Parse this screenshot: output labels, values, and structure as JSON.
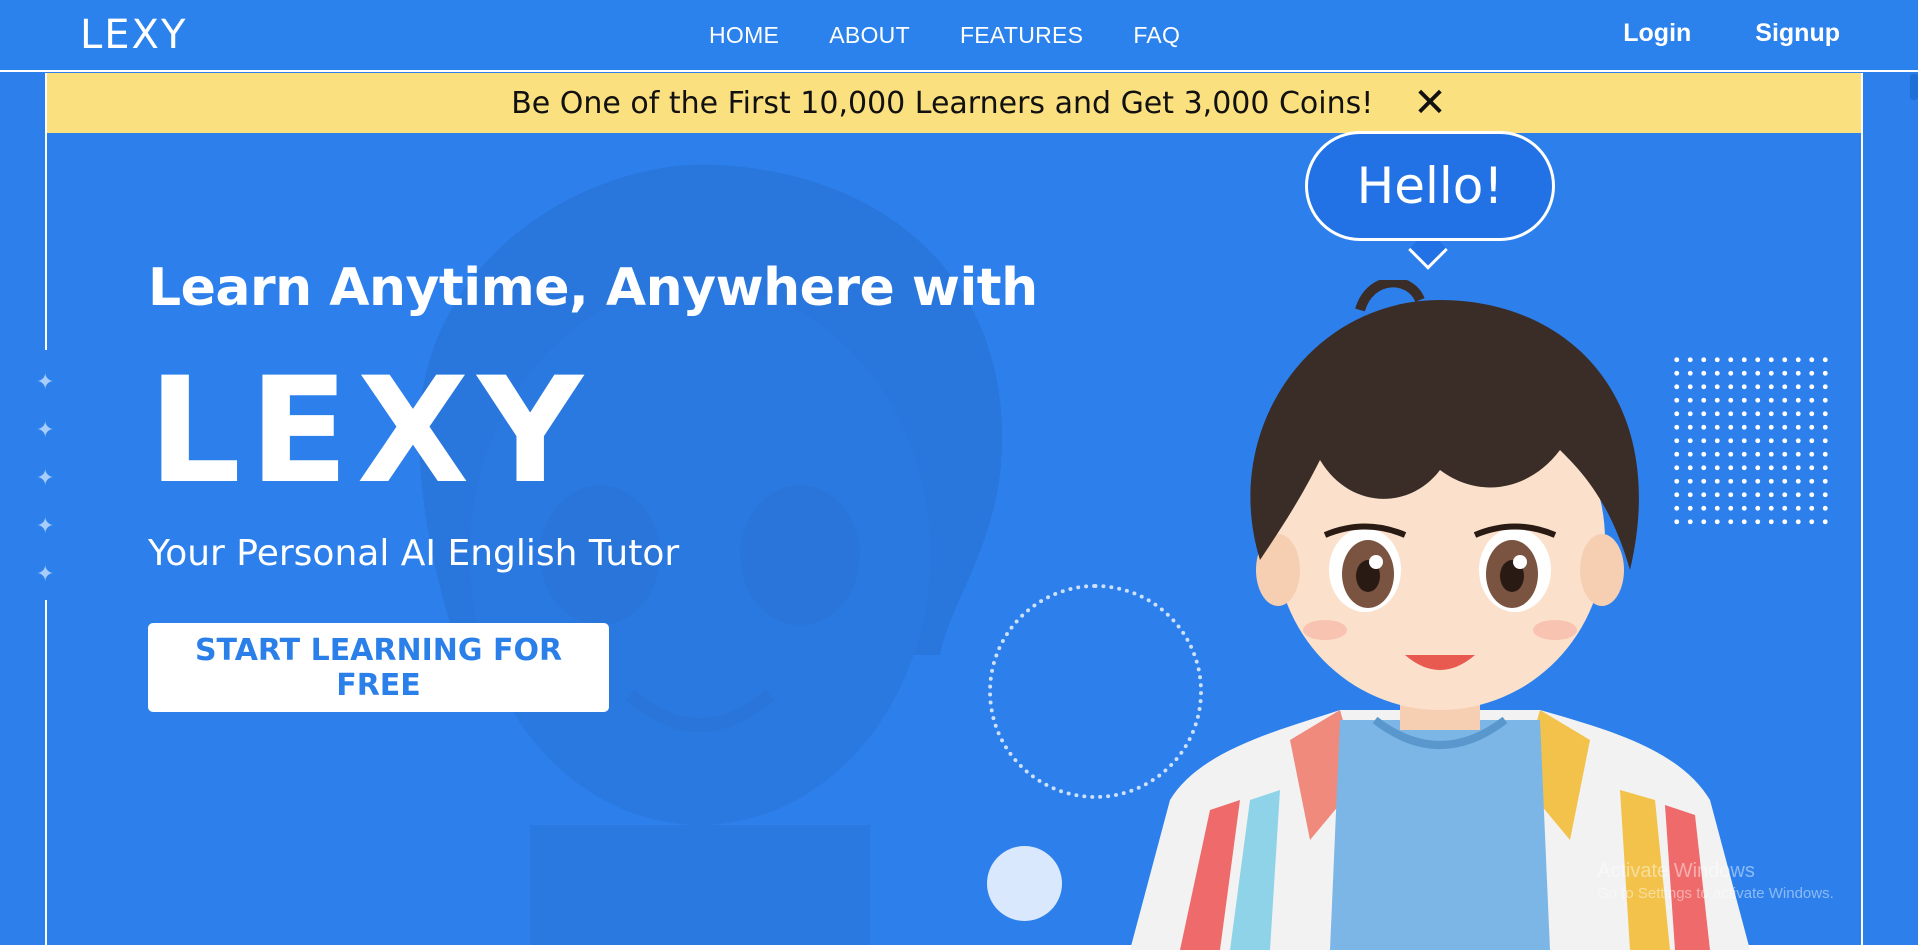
{
  "header": {
    "logo": "LEXY",
    "nav": [
      "HOME",
      "ABOUT",
      "FEATURES",
      "FAQ"
    ],
    "login": "Login",
    "signup": "Signup"
  },
  "banner": {
    "text": "Be One of the First 10,000 Learners and Get 3,000 Coins!",
    "close_glyph": "✕"
  },
  "hero": {
    "headline": "Learn Anytime, Anywhere with",
    "brand": "LEXY",
    "tagline": "Your Personal AI English Tutor",
    "cta": "START LEARNING FOR FREE",
    "speech": "Hello!"
  },
  "watermark": {
    "title": "Activate Windows",
    "subtitle": "Go to Settings to activate Windows."
  },
  "colors": {
    "background": "#2d80ec",
    "banner": "#fbe07f",
    "cta_text": "#2b7fe9",
    "speech_bubble": "#2272e6"
  },
  "icons": [
    "close-icon",
    "sparkle-icon",
    "mascot-illustration"
  ]
}
